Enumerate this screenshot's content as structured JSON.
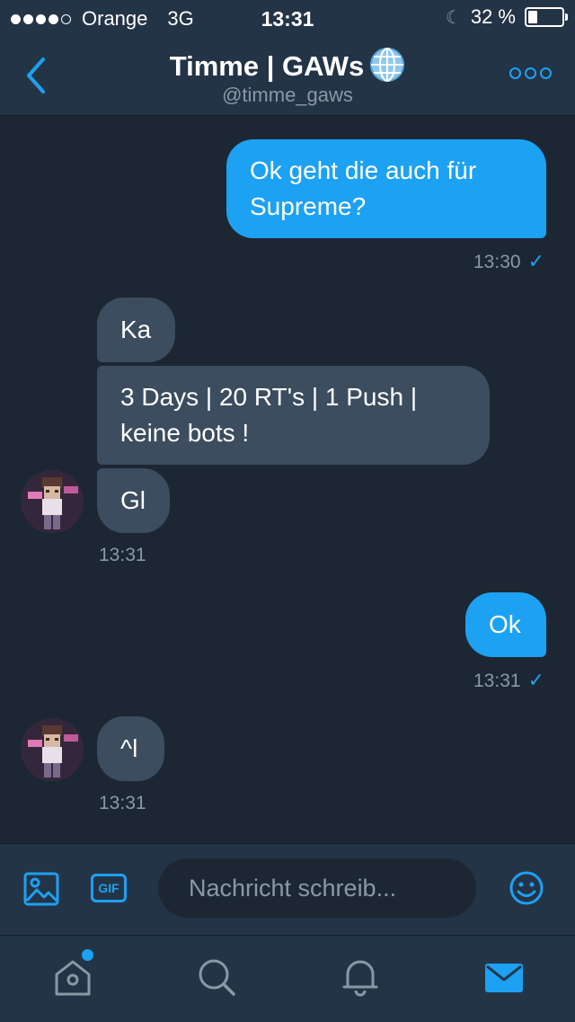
{
  "status_bar": {
    "carrier": "Orange",
    "network": "3G",
    "time": "13:31",
    "battery_percent_label": "32 %",
    "battery_level": 0.32
  },
  "header": {
    "title": "Timme | GAWs",
    "handle": "@timme_gaws",
    "title_icon": "globe-icon",
    "back_icon": "chevron-left-icon",
    "more_icon": "more-icon"
  },
  "messages": [
    {
      "direction": "sent",
      "lines": [
        "Ok geht die auch für",
        "Supreme?"
      ]
    },
    {
      "direction": "sent_meta",
      "time": "13:30",
      "status": "✓"
    },
    {
      "direction": "received",
      "lines": [
        "Ka"
      ]
    },
    {
      "direction": "received",
      "lines": [
        "3 Days | 20 RT's | 1 Push |",
        "keine bots !"
      ]
    },
    {
      "direction": "received",
      "lines": [
        "Gl"
      ]
    },
    {
      "direction": "received_meta",
      "time": "13:31"
    },
    {
      "direction": "sent",
      "lines": [
        "Ok"
      ]
    },
    {
      "direction": "sent_meta",
      "time": "13:31",
      "status": "✓"
    },
    {
      "direction": "received",
      "lines": [
        "^l"
      ]
    },
    {
      "direction": "received_meta",
      "time": "13:31"
    }
  ],
  "composer": {
    "placeholder": "Nachricht schreib...",
    "gif_label": "GIF",
    "photo_icon": "photo-icon",
    "emoji_icon": "emoji-icon"
  },
  "tabbar": {
    "items": [
      "home-icon",
      "search-icon",
      "bell-icon",
      "mail-icon"
    ],
    "active": "mail-icon"
  },
  "colors": {
    "accent": "#1da1f2",
    "background": "#1c2733",
    "bar": "#243447",
    "received_bubble": "#3b4d5f",
    "muted": "#8899a6"
  }
}
